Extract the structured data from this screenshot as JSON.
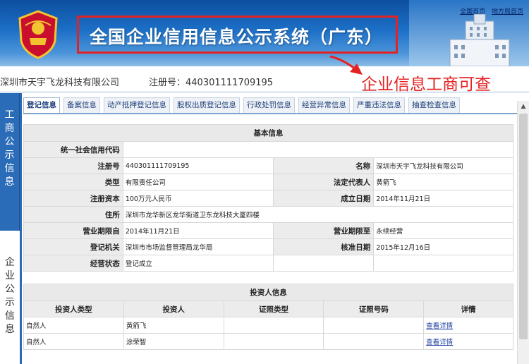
{
  "header": {
    "title": "全国企业信用信息公示系统（广东）",
    "links": [
      "全国首页",
      "地方局首页"
    ]
  },
  "company": {
    "name": "深圳市天宇飞龙科技有限公司",
    "reg_label": "注册号：440301111709195"
  },
  "annotation": "企业信息工商可查",
  "side_tabs": [
    "工商公示信息",
    "企业公示信息"
  ],
  "tabs": [
    "登记信息",
    "备案信息",
    "动产抵押登记信息",
    "股权出质登记信息",
    "行政处罚信息",
    "经营异常信息",
    "严重违法信息",
    "抽查检查信息"
  ],
  "basic": {
    "title": "基本信息",
    "credit_code_label": "统一社会信用代码",
    "credit_code": "",
    "reg_no_label": "注册号",
    "reg_no": "440301111709195",
    "name_label": "名称",
    "name": "深圳市天宇飞龙科技有限公司",
    "type_label": "类型",
    "type": "有限责任公司",
    "rep_label": "法定代表人",
    "rep": "黄箭飞",
    "capital_label": "注册资本",
    "capital": "100万元人民币",
    "found_label": "成立日期",
    "found": "2014年11月21日",
    "addr_label": "住所",
    "addr": "深圳市龙华新区龙华街道卫东龙科技大厦四楼",
    "from_label": "营业期限自",
    "from": "2014年11月21日",
    "to_label": "营业期限至",
    "to": "永续经营",
    "authority_label": "登记机关",
    "authority": "深圳市市场监督管理局龙华局",
    "approve_label": "核准日期",
    "approve": "2015年12月16日",
    "status_label": "经营状态",
    "status": "登记成立"
  },
  "investors": {
    "title": "投资人信息",
    "columns": [
      "投资人类型",
      "投资人",
      "证照类型",
      "证照号码",
      "详情"
    ],
    "rows": [
      {
        "type": "自然人",
        "name": "黄箭飞",
        "id_type": "",
        "id_no": "",
        "detail": "查看详情"
      },
      {
        "type": "自然人",
        "name": "涂荣智",
        "id_type": "",
        "id_no": "",
        "detail": "查看详情"
      }
    ]
  }
}
